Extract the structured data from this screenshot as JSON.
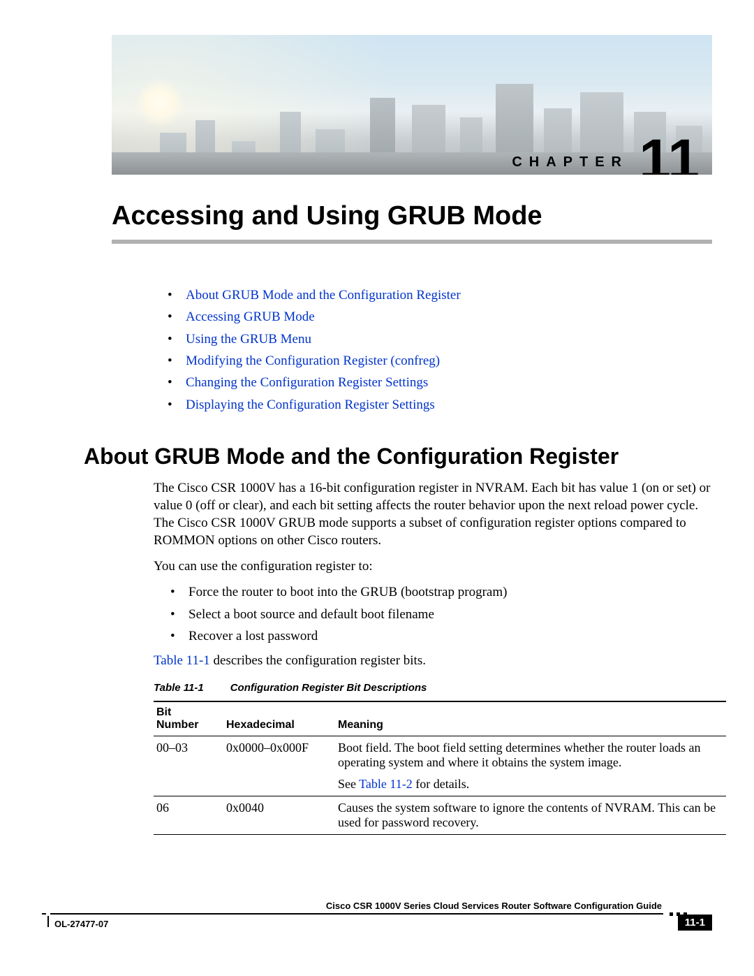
{
  "chapter": {
    "label": "CHAPTER",
    "number": "11"
  },
  "title": "Accessing and Using GRUB Mode",
  "toc": [
    "About GRUB Mode and the Configuration Register",
    "Accessing GRUB Mode",
    "Using the GRUB Menu",
    "Modifying the Configuration Register (confreg)",
    "Changing the Configuration Register Settings",
    "Displaying the Configuration Register Settings"
  ],
  "section_heading": "About GRUB Mode and the Configuration Register",
  "para1": "The Cisco CSR 1000V has a 16-bit configuration register in NVRAM. Each bit has value 1 (on or set) or value 0 (off or clear), and each bit setting affects the router behavior upon the next reload power cycle. The Cisco CSR 1000V GRUB mode supports a subset of configuration register options compared to ROMMON options on other Cisco routers.",
  "para2": "You can use the configuration register to:",
  "uses": [
    "Force the router to boot into the GRUB (bootstrap program)",
    "Select a boot source and default boot filename",
    "Recover a lost password"
  ],
  "para3a": "Table 11-1",
  "para3b": " describes the configuration register bits.",
  "table_caption": {
    "id": "Table 11-1",
    "title": "Configuration Register Bit Descriptions"
  },
  "table": {
    "headers": {
      "col1a": "Bit",
      "col1b": "Number",
      "col2": "Hexadecimal",
      "col3": "Meaning"
    },
    "rows": [
      {
        "bit": "00–03",
        "hex": "0x0000–0x000F",
        "meaning": "Boot field. The boot field setting determines whether the router loads an operating system and where it obtains the system image.",
        "see_prefix": "See ",
        "see_link": "Table 11-2",
        "see_suffix": " for details."
      },
      {
        "bit": "06",
        "hex": "0x0040",
        "meaning": "Causes the system software to ignore the contents of NVRAM. This can be used for password recovery."
      }
    ]
  },
  "footer": {
    "guide": "Cisco CSR 1000V Series Cloud Services Router Software Configuration Guide",
    "docnum": "OL-27477-07",
    "page": "11-1"
  }
}
